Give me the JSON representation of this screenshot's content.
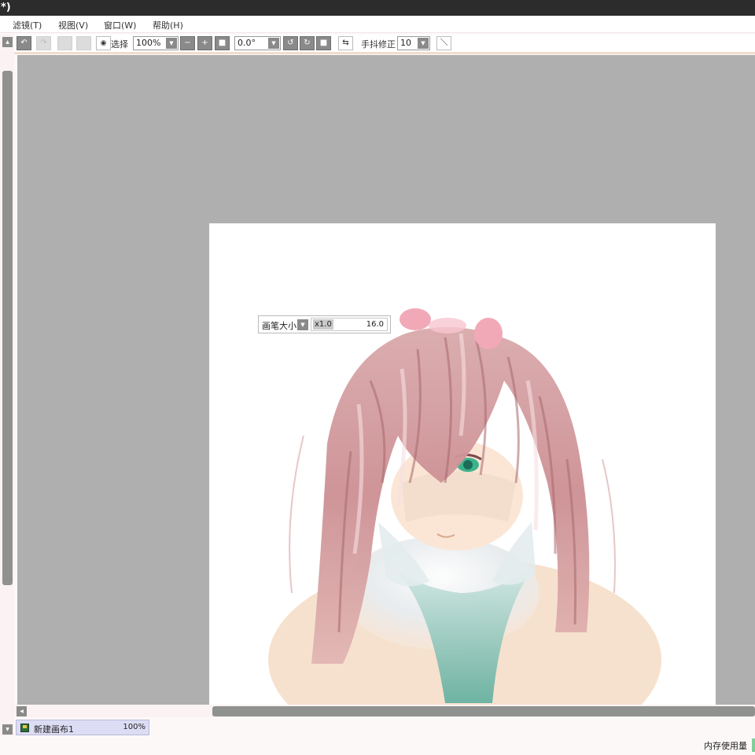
{
  "window": {
    "title": "*)"
  },
  "menu": {
    "filter": "滤镜(T)",
    "view": "视图(V)",
    "window": "窗口(W)",
    "help": "帮助(H)"
  },
  "toolbar": {
    "select_label": "选择",
    "zoom_value": "100%",
    "rotation_value": "0.0°",
    "stabilizer_label": "手抖修正",
    "stabilizer_value": "10"
  },
  "brush_popup": {
    "label": "画笔大小",
    "multiplier": "x1.0",
    "value": "16.0"
  },
  "canvas_tab": {
    "name": "新建画布1",
    "zoom": "100%"
  },
  "status": {
    "memory_label": "内存使用量"
  },
  "icons": {
    "undo": "undo-icon",
    "redo": "redo-icon",
    "eye": "eye-icon",
    "zoom_out": "minus-icon",
    "zoom_in": "plus-icon",
    "zoom_reset": "square-icon",
    "rotate_left": "rotate-left-icon",
    "rotate_right": "rotate-right-icon",
    "rotate_reset": "square-icon",
    "flip": "flip-horizontal-icon",
    "line": "line-icon"
  },
  "colors": {
    "titlebar": "#2c2c2c",
    "workspace": "#b0afb0",
    "canvas": "#ffffff",
    "button": "#8a8a8a",
    "tab_active": "#dcdcf4"
  }
}
